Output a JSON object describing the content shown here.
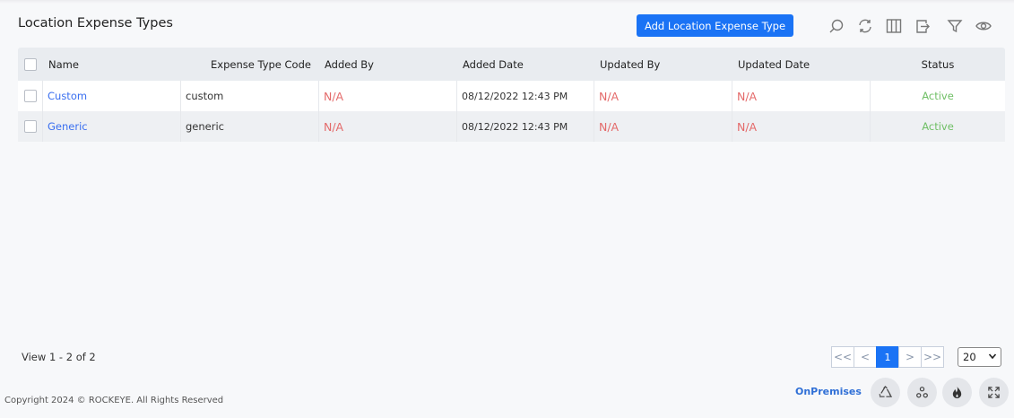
{
  "page": {
    "title": "Location Expense Types"
  },
  "toolbar": {
    "add_label": "Add Location Expense Type",
    "icons": [
      "search-icon",
      "refresh-icon",
      "columns-icon",
      "export-icon",
      "filter-icon",
      "eye-icon"
    ]
  },
  "table": {
    "headers": {
      "name": "Name",
      "code": "Expense Type Code",
      "added_by": "Added By",
      "added_date": "Added Date",
      "updated_by": "Updated By",
      "updated_date": "Updated Date",
      "status": "Status"
    },
    "rows": [
      {
        "name": "Custom",
        "code": "custom",
        "added_by": "N/A",
        "added_date": "08/12/2022 12:43 PM",
        "updated_by": "N/A",
        "updated_date": "N/A",
        "status": "Active"
      },
      {
        "name": "Generic",
        "code": "generic",
        "added_by": "N/A",
        "added_date": "08/12/2022 12:43 PM",
        "updated_by": "N/A",
        "updated_date": "N/A",
        "status": "Active"
      }
    ]
  },
  "pagination": {
    "view_info": "View 1 - 2 of 2",
    "first": "<<",
    "prev": "<",
    "current": "1",
    "next": ">",
    "last": ">>",
    "page_size": "20"
  },
  "footer": {
    "copyright": "Copyright 2024 © ROCKEYE. All Rights Reserved",
    "mode": "OnPremises",
    "buttons": [
      "recycle-icon",
      "cluster-icon",
      "fire-icon",
      "expand-icon"
    ]
  },
  "colors": {
    "accent": "#1a73f5",
    "na": "#e46a6a",
    "active": "#6fbf65",
    "link": "#3a6ff0"
  }
}
